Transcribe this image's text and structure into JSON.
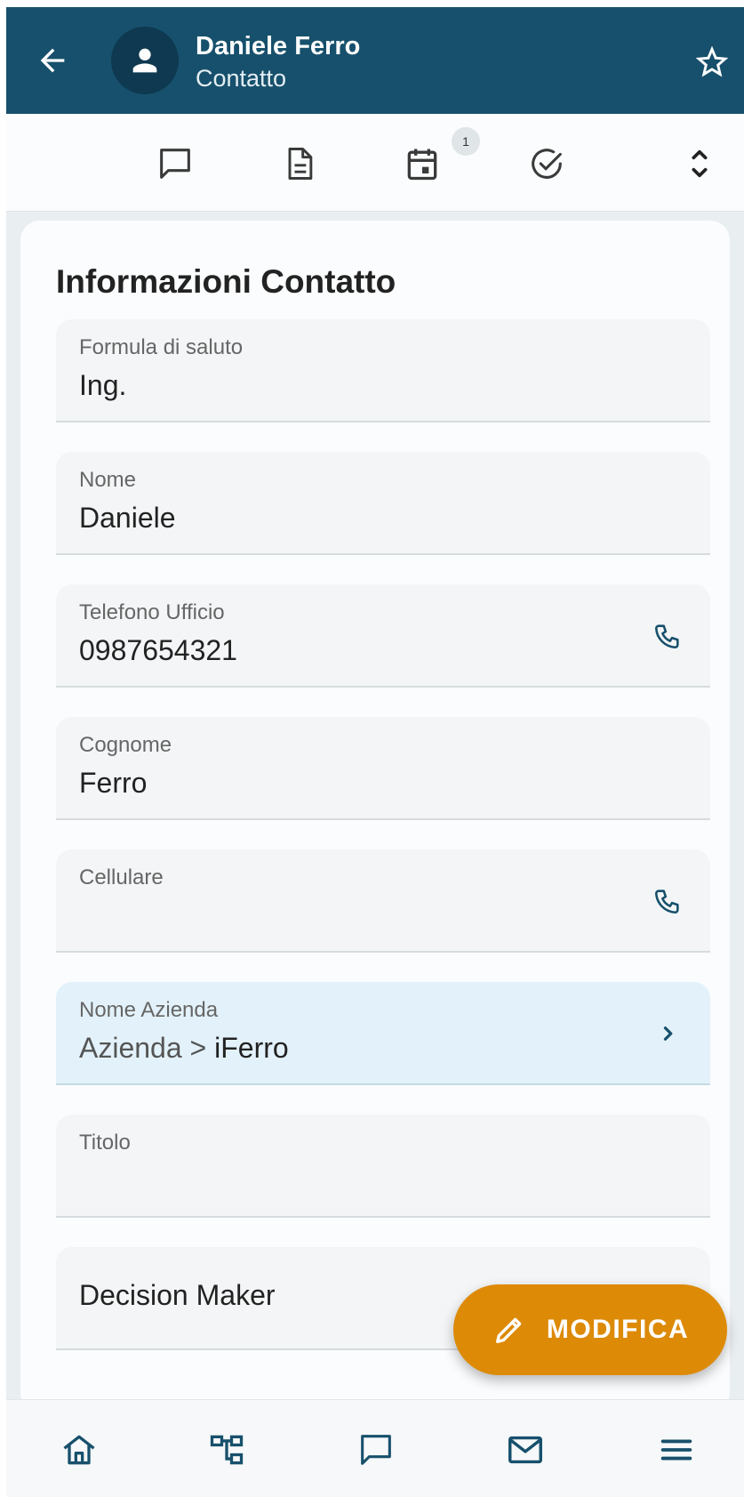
{
  "header": {
    "name": "Daniele Ferro",
    "subtitle": "Contatto",
    "back_icon": "arrow-left-icon",
    "avatar_icon": "person-icon",
    "favorite_icon": "star-outline-icon",
    "color": "#17506c"
  },
  "toolbar": {
    "icons": [
      "comment-icon",
      "document-icon",
      "calendar-icon",
      "check-circle-icon",
      "expand-icon"
    ],
    "calendar_badge": "1"
  },
  "section": {
    "title": "Informazioni Contatto"
  },
  "fields": {
    "salutation": {
      "label": "Formula di saluto",
      "value": "Ing."
    },
    "first_name": {
      "label": "Nome",
      "value": "Daniele"
    },
    "office_phone": {
      "label": "Telefono Ufficio",
      "value": "0987654321",
      "icon": "phone-icon"
    },
    "last_name": {
      "label": "Cognome",
      "value": "Ferro"
    },
    "mobile": {
      "label": "Cellulare",
      "value": "",
      "icon": "phone-icon"
    },
    "company": {
      "label": "Nome Azienda",
      "prefix": "Azienda > ",
      "value": "iFerro",
      "icon": "chevron-right-icon"
    },
    "title": {
      "label": "Titolo",
      "value": ""
    },
    "decision_maker": {
      "value": "Decision Maker"
    }
  },
  "fab": {
    "label": "MODIFICA",
    "icon": "pencil-icon",
    "color": "#dd8a07"
  },
  "bottom_nav": {
    "icons": [
      "home-icon",
      "hierarchy-icon",
      "comment-icon",
      "mail-icon",
      "menu-icon"
    ]
  }
}
